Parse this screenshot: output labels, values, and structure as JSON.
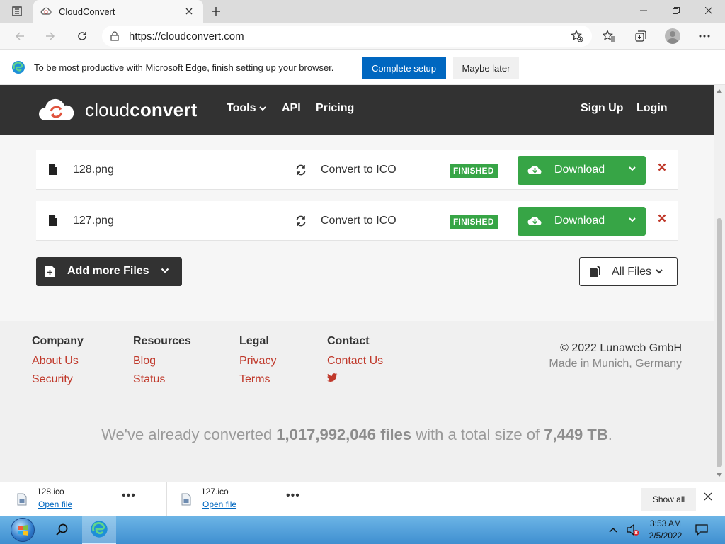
{
  "browser": {
    "tab_title": "CloudConvert",
    "url": "https://cloudconvert.com"
  },
  "infobar": {
    "message": "To be most productive with Microsoft Edge, finish setting up your browser.",
    "complete_setup": "Complete setup",
    "maybe_later": "Maybe later"
  },
  "site": {
    "brand_light": "cloud",
    "brand_bold": "convert",
    "nav": {
      "tools": "Tools",
      "api": "API",
      "pricing": "Pricing",
      "signup": "Sign Up",
      "login": "Login"
    }
  },
  "files": [
    {
      "name": "128.png",
      "convert": "Convert to ICO",
      "status": "FINISHED",
      "download": "Download"
    },
    {
      "name": "127.png",
      "convert": "Convert to ICO",
      "status": "FINISHED",
      "download": "Download"
    }
  ],
  "actions": {
    "add_more": "Add more Files",
    "all_files": "All Files"
  },
  "footer": {
    "company": {
      "heading": "Company",
      "links": [
        "About Us",
        "Security"
      ]
    },
    "resources": {
      "heading": "Resources",
      "links": [
        "Blog",
        "Status"
      ]
    },
    "legal": {
      "heading": "Legal",
      "links": [
        "Privacy",
        "Terms"
      ]
    },
    "contact": {
      "heading": "Contact",
      "links": [
        "Contact Us"
      ]
    },
    "copyright": "© 2022 Lunaweb GmbH",
    "made_in": "Made in Munich, Germany",
    "stats": {
      "prefix": "We've already converted ",
      "files": "1,017,992,046 files",
      "middle": " with a total size of ",
      "size": "7,449 TB",
      "suffix": "."
    }
  },
  "downloads": [
    {
      "name": "128.ico",
      "action": "Open file"
    },
    {
      "name": "127.ico",
      "action": "Open file"
    }
  ],
  "shelf": {
    "show_all": "Show all"
  },
  "taskbar": {
    "time": "3:53 AM",
    "date": "2/5/2022"
  },
  "colors": {
    "accent_green": "#37a546",
    "edge_blue": "#0067c0",
    "link_red": "#c0392b",
    "nav_dark": "#323232"
  }
}
